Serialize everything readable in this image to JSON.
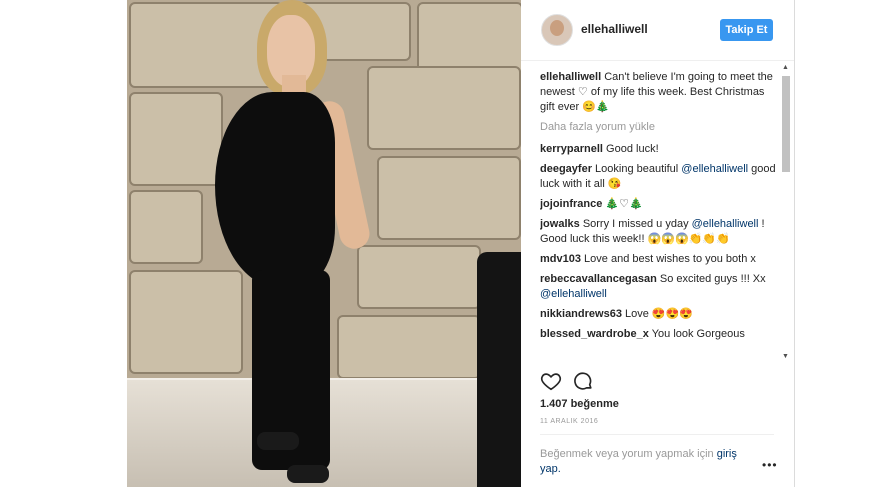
{
  "post": {
    "username": "ellehalliwell",
    "follow_label": "Takip Et",
    "caption": {
      "user": "ellehalliwell",
      "text": "Can't believe I'm going to meet the newest ♡ of my life this week. Best Christmas gift ever 😊🎄"
    },
    "load_more": "Daha fazla yorum yükle",
    "comments": [
      {
        "user": "kerryparnell",
        "text": "Good luck!"
      },
      {
        "user": "deegayfer",
        "text": "Looking beautiful",
        "mention": "@ellehalliwell",
        "text2": "good luck with it all 😘"
      },
      {
        "user": "jojoinfrance",
        "text": "🎄♡🎄"
      },
      {
        "user": "jowalks",
        "text": "Sorry I missed u yday",
        "mention": "@ellehalliwell",
        "text2": "! Good luck this week!! 😱😱😱👏👏👏"
      },
      {
        "user": "mdv103",
        "text": "Love and best wishes to you both x"
      },
      {
        "user": "rebeccavallancegasan",
        "text": "So excited guys !!! Xx",
        "mention": "@ellehalliwell"
      },
      {
        "user": "nikkiandrews63",
        "text": "Love 😍😍😍"
      },
      {
        "user": "blessed_wardrobe_x",
        "text": "You look Gorgeous"
      }
    ],
    "likes": "1.407 beğenme",
    "date": "11 ARALIK 2016",
    "login_prompt": "Beğenmek veya yorum yapmak için",
    "login_link": "giriş yap.",
    "icons": {
      "like": "heart-icon",
      "comment": "comment-icon",
      "more": "more-options-icon"
    }
  }
}
